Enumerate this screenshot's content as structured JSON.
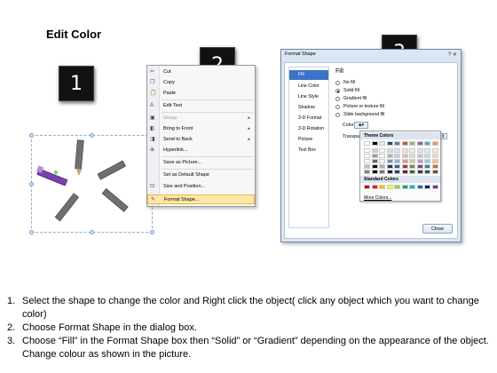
{
  "title": "Edit Color",
  "steps": [
    "1",
    "2",
    "3"
  ],
  "context_menu": {
    "items": [
      {
        "label": "Cut",
        "icon": "scissors-icon",
        "glyph": "✂"
      },
      {
        "label": "Copy",
        "icon": "copy-icon",
        "glyph": "❐"
      },
      {
        "label": "Paste",
        "icon": "paste-icon",
        "glyph": "📋"
      },
      {
        "label": "Edit Text",
        "icon": "edit-text-icon",
        "glyph": "A"
      },
      {
        "label": "Group",
        "icon": "group-icon",
        "glyph": "▣",
        "disabled": true,
        "submenu": true
      },
      {
        "label": "Bring to Front",
        "icon": "bring-front-icon",
        "glyph": "◧",
        "submenu": true
      },
      {
        "label": "Send to Back",
        "icon": "send-back-icon",
        "glyph": "◨",
        "submenu": true
      },
      {
        "label": "Hyperlink...",
        "icon": "hyperlink-icon",
        "glyph": "⊕"
      },
      {
        "label": "Save as Picture...",
        "icon": "",
        "glyph": ""
      },
      {
        "label": "Set as Default Shape",
        "icon": "",
        "glyph": ""
      },
      {
        "label": "Size and Position...",
        "icon": "size-position-icon",
        "glyph": "⊡"
      },
      {
        "label": "Format Shape...",
        "icon": "format-shape-icon",
        "glyph": "✎",
        "highlight": true
      }
    ]
  },
  "dialog": {
    "title": "Format Shape",
    "nav": [
      "Fill",
      "Line Color",
      "Line Style",
      "Shadow",
      "3-D Format",
      "3-D Rotation",
      "Picture",
      "Text Box"
    ],
    "active_nav": "Fill",
    "section_heading": "Fill",
    "fill_options": [
      "No fill",
      "Solid fill",
      "Gradient fill",
      "Picture or texture fill",
      "Slide background fill"
    ],
    "selected_fill": "Solid fill",
    "color_label": "Color:",
    "transparency_label": "Transpa",
    "palette": {
      "theme_heading": "Theme Colors",
      "standard_heading": "Standard Colors",
      "more_colors": "More Colors...",
      "theme_top_row": [
        "#ffffff",
        "#000000",
        "#eeece1",
        "#1f497d",
        "#4f81bd",
        "#c0504d",
        "#9bbb59",
        "#8064a2",
        "#4bacc6",
        "#f79646"
      ],
      "standard_row": [
        "#c00000",
        "#ff0000",
        "#ffc000",
        "#ffff00",
        "#92d050",
        "#00b050",
        "#00b0f0",
        "#0070c0",
        "#002060",
        "#7030a0"
      ]
    },
    "close_label": "Close"
  },
  "instructions": [
    {
      "num": "1.",
      "text": "Select the shape to change the color and Right click the object( click any object which you want to change color)"
    },
    {
      "num": "2.",
      "text": "Choose Format Shape in the dialog box."
    },
    {
      "num": "3.",
      "text": "Choose “Fill” in the Format Shape box then “Solid” or “Gradient” depending on the appearance of the object. Change colour as shown in the picture."
    }
  ]
}
